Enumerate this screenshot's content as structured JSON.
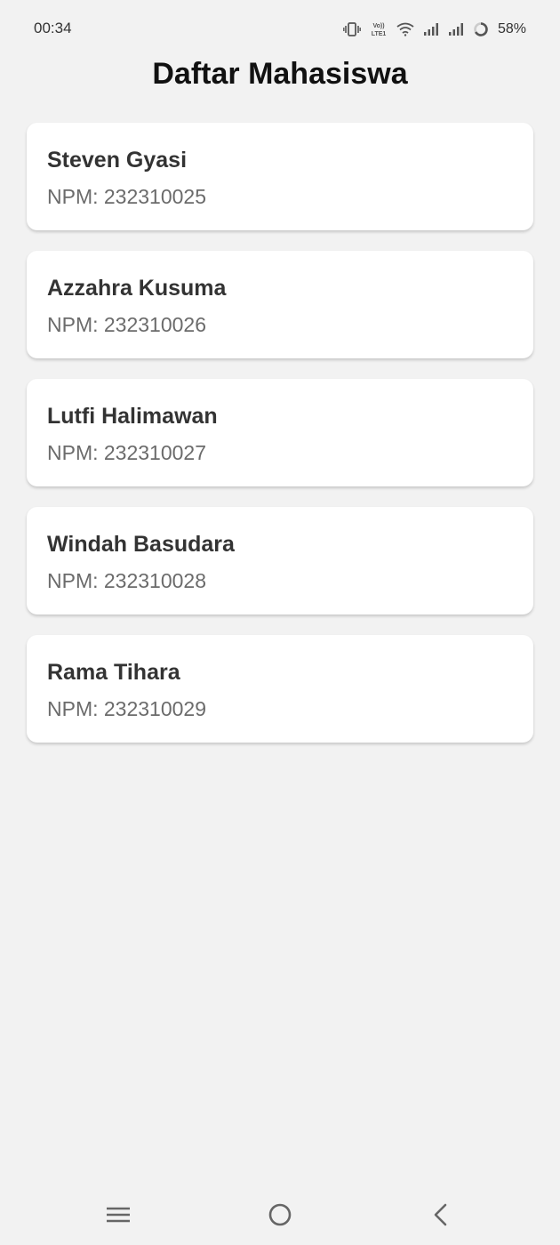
{
  "status_bar": {
    "time": "00:34",
    "battery": "58%",
    "icons": [
      "vibrate-icon",
      "volte-icon",
      "wifi-icon",
      "signal-icon",
      "signal-icon",
      "battery-ring-icon"
    ]
  },
  "page": {
    "title": "Daftar Mahasiswa"
  },
  "students": [
    {
      "name": "Steven Gyasi",
      "npm": "NPM: 232310025"
    },
    {
      "name": "Azzahra Kusuma",
      "npm": "NPM: 232310026"
    },
    {
      "name": "Lutfi Halimawan",
      "npm": "NPM: 232310027"
    },
    {
      "name": "Windah Basudara",
      "npm": "NPM: 232310028"
    },
    {
      "name": "Rama Tihara",
      "npm": "NPM: 232310029"
    }
  ],
  "nav_bar": {
    "icons": [
      "menu-icon",
      "home-icon",
      "back-icon"
    ]
  },
  "colors": {
    "background": "#f2f2f2",
    "card": "#ffffff",
    "name_text": "#333333",
    "npm_text": "#6b6b6b"
  }
}
